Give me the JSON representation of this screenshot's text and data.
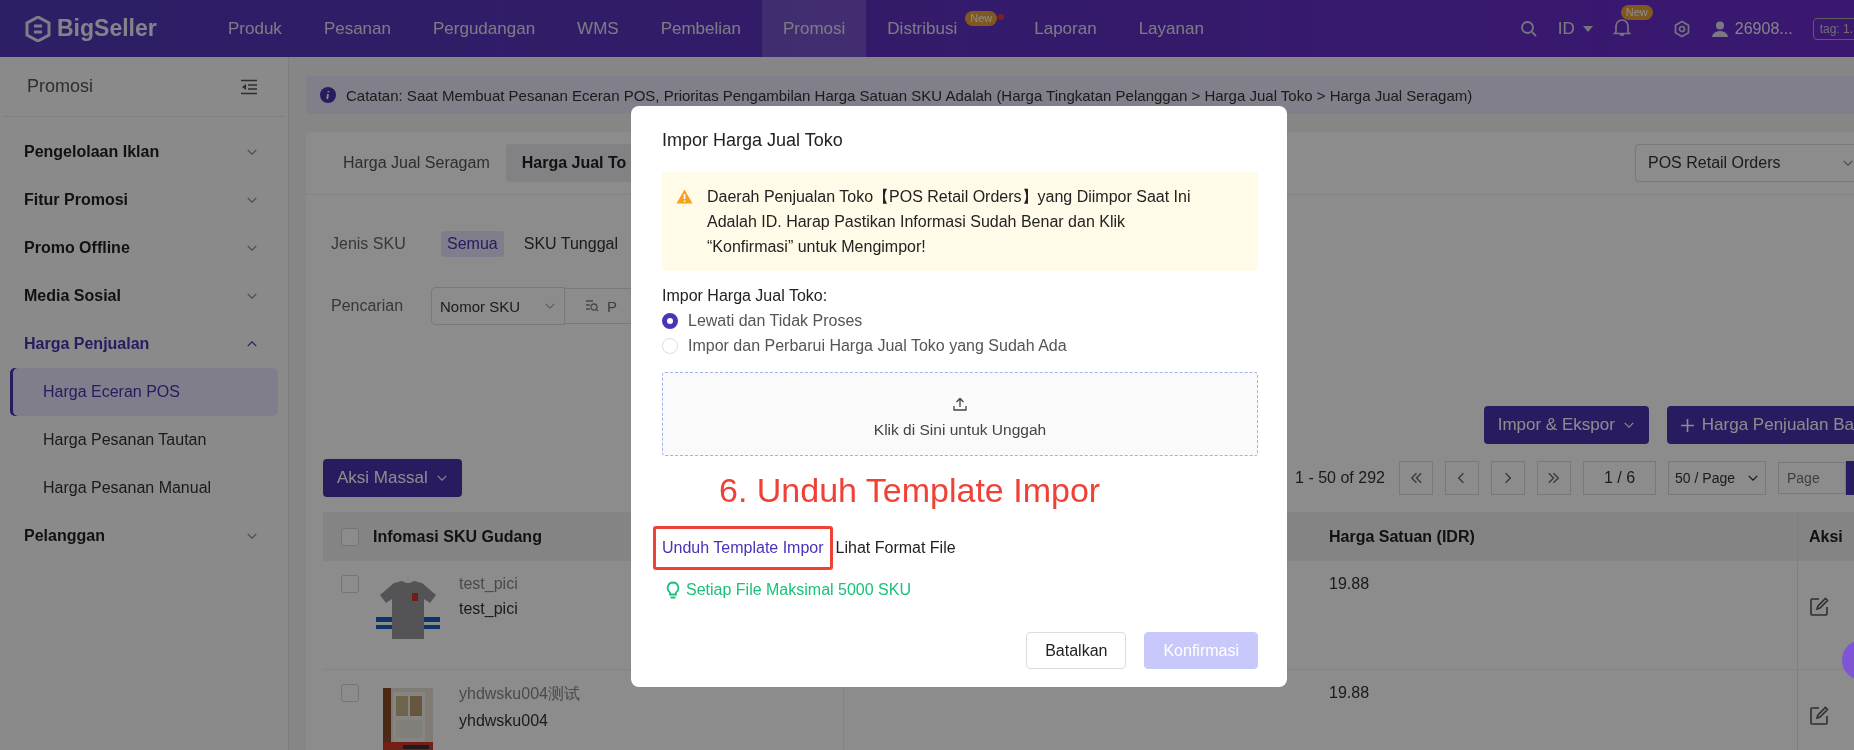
{
  "top_bar": {
    "logo": "BigSeller",
    "nav": [
      {
        "label": "Produk",
        "selected": false,
        "dot": false
      },
      {
        "label": "Pesanan",
        "selected": false,
        "dot": false
      },
      {
        "label": "Pergudangan",
        "selected": false,
        "dot": false
      },
      {
        "label": "WMS",
        "selected": false,
        "dot": false
      },
      {
        "label": "Pembelian",
        "selected": false,
        "dot": false
      },
      {
        "label": "Promosi",
        "selected": true,
        "dot": false
      },
      {
        "label": "Distribusi",
        "selected": false,
        "dot": true,
        "badge": "New"
      },
      {
        "label": "Laporan",
        "selected": false,
        "dot": false
      },
      {
        "label": "Layanan",
        "selected": false,
        "dot": false
      }
    ],
    "language": "ID",
    "notification_badge": "New",
    "user": "26908...",
    "tag": "tag: 1."
  },
  "sidebar": {
    "title": "Promosi",
    "items": [
      {
        "label": "Pengelolaan Iklan",
        "expanded": false
      },
      {
        "label": "Fitur Promosi",
        "expanded": false
      },
      {
        "label": "Promo Offline",
        "expanded": false
      },
      {
        "label": "Media Sosial",
        "expanded": false
      },
      {
        "label": "Harga Penjualan",
        "expanded": true,
        "children": [
          {
            "label": "Harga Eceran POS",
            "selected": true
          },
          {
            "label": "Harga Pesanan Tautan",
            "selected": false
          },
          {
            "label": "Harga Pesanan Manual",
            "selected": false
          }
        ]
      },
      {
        "label": "Pelanggan",
        "expanded": false
      }
    ]
  },
  "notice": "Catatan: Saat Membuat Pesanan Eceran POS, Prioritas Pengambilan Harga Satuan SKU Adalah (Harga Tingkatan Pelanggan > Harga Jual Toko > Harga Jual Seragam)",
  "tabs": [
    {
      "label": "Harga Jual Seragam",
      "selected": false
    },
    {
      "label": "Harga Jual To",
      "selected": true
    }
  ],
  "store_select": "POS Retail Orders",
  "filters": {
    "sku_type_label": "Jenis SKU",
    "sku_type_options": [
      {
        "label": "Semua",
        "selected": true
      },
      {
        "label": "SKU Tunggal",
        "selected": false
      }
    ],
    "search_label": "Pencarian",
    "search_field": "Nomor SKU",
    "search_placeholder": "P"
  },
  "actions": [
    "Impor & Ekspor",
    "Harga Penjualan Ba"
  ],
  "bulk_action": "Aksi Massal",
  "pagination": {
    "summary": "1 - 50 of 292",
    "page": "1 / 6",
    "page_size": "50 / Page",
    "jump_placeholder": "Page"
  },
  "table": {
    "select_all_checked": false,
    "columns": [
      "Infomasi SKU Gudang",
      "Harga Satuan (IDR)",
      "Aksi"
    ],
    "rows": [
      {
        "checked": false,
        "name": "test_pici",
        "sku": "test_pici",
        "price": "19.88"
      },
      {
        "checked": false,
        "name": "yhdwsku004测试",
        "sku": "yhdwsku004",
        "price": "19.88"
      }
    ]
  },
  "modal": {
    "title": "Impor Harga Jual Toko",
    "warning": "Daerah Penjualan Toko【POS Retail Orders】yang Diimpor Saat Ini Adalah ID. Harap Pastikan Informasi Sudah Benar dan Klik “Konfirmasi” untuk Mengimpor!",
    "option_label": "Impor Harga Jual Toko:",
    "options": [
      {
        "label": "Lewati dan Tidak Proses",
        "selected": true
      },
      {
        "label": "Impor dan Perbarui Harga Jual Toko yang Sudah Ada",
        "selected": false
      }
    ],
    "upload_hint": "Klik di Sini untuk Unggah",
    "download_link": "Unduh Template Impor",
    "format_link": "Lihat Format File",
    "tip": "Setiap File Maksimal 5000 SKU",
    "buttons": [
      {
        "label": "Batalkan",
        "kind": "secondary",
        "disabled": false
      },
      {
        "label": "Konfirmasi",
        "kind": "primary",
        "disabled": true
      }
    ]
  },
  "annotation": "6. Unduh Template Impor"
}
